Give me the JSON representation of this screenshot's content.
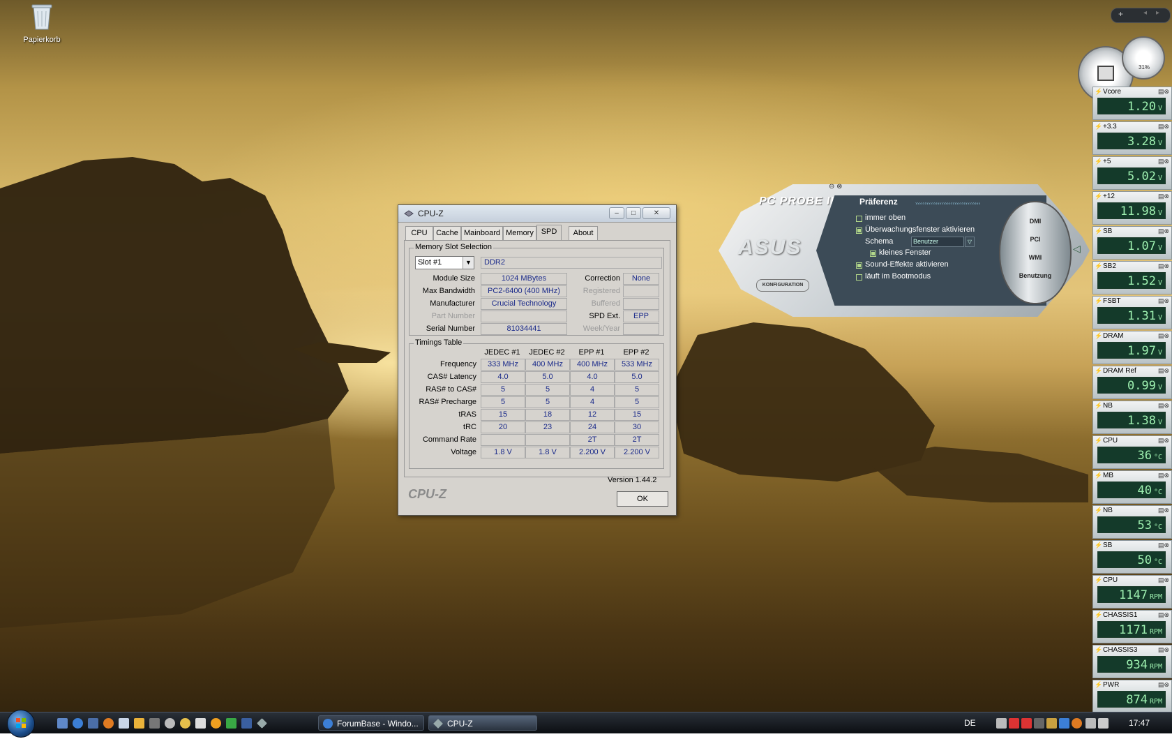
{
  "desktop": {
    "icon_label": "Papierkorb"
  },
  "cpuz": {
    "title": "CPU-Z",
    "tabs": [
      "CPU",
      "Cache",
      "Mainboard",
      "Memory",
      "SPD",
      "About"
    ],
    "active_tab": "SPD",
    "slot_group_title": "Memory Slot Selection",
    "slot_selected": "Slot #1",
    "mem_type": "DDR2",
    "labels": {
      "module_size": "Module Size",
      "max_bandwidth": "Max Bandwidth",
      "manufacturer": "Manufacturer",
      "part_number": "Part Number",
      "serial_number": "Serial Number",
      "correction": "Correction",
      "registered": "Registered",
      "buffered": "Buffered",
      "spd_ext": "SPD Ext.",
      "week_year": "Week/Year"
    },
    "values": {
      "module_size": "1024 MBytes",
      "max_bandwidth": "PC2-6400 (400 MHz)",
      "manufacturer": "Crucial Technology",
      "part_number": "",
      "serial_number": "81034441",
      "correction": "None",
      "registered": "",
      "buffered": "",
      "spd_ext": "EPP",
      "week_year": ""
    },
    "timings": {
      "title": "Timings Table",
      "columns": [
        "JEDEC #1",
        "JEDEC #2",
        "EPP #1",
        "EPP #2"
      ],
      "rows": [
        {
          "label": "Frequency",
          "cells": [
            "333 MHz",
            "400 MHz",
            "400 MHz",
            "533 MHz"
          ]
        },
        {
          "label": "CAS# Latency",
          "cells": [
            "4.0",
            "5.0",
            "4.0",
            "5.0"
          ]
        },
        {
          "label": "RAS# to CAS#",
          "cells": [
            "5",
            "5",
            "4",
            "5"
          ]
        },
        {
          "label": "RAS# Precharge",
          "cells": [
            "5",
            "5",
            "4",
            "5"
          ]
        },
        {
          "label": "tRAS",
          "cells": [
            "15",
            "18",
            "12",
            "15"
          ]
        },
        {
          "label": "tRC",
          "cells": [
            "20",
            "23",
            "24",
            "30"
          ]
        },
        {
          "label": "Command Rate",
          "cells": [
            "",
            "",
            "2T",
            "2T"
          ]
        },
        {
          "label": "Voltage",
          "cells": [
            "1.8 V",
            "1.8 V",
            "2.200 V",
            "2.200 V"
          ]
        }
      ]
    },
    "version": "Version 1.44.2",
    "logo": "CPU-Z",
    "ok_label": "OK"
  },
  "probe": {
    "title": "PC PROBE II",
    "brand": "ASUS",
    "config_label": "KONFIGURATION",
    "pref_title": "Präferenz",
    "items": [
      {
        "label": "immer oben",
        "checked": false
      },
      {
        "label": "Überwachungsfenster aktivieren",
        "checked": true
      },
      {
        "label": "Schema",
        "checked": null
      },
      {
        "label": "kleines Fenster",
        "checked": true
      },
      {
        "label": "Sound-Effekte aktivieren",
        "checked": true
      },
      {
        "label": "läuft im Bootmodus",
        "checked": false
      }
    ],
    "schema_value": "Benutzer",
    "nav_buttons": [
      "DMI",
      "PCI",
      "WMI",
      "Benutzung"
    ]
  },
  "sidebar": {
    "gauge_percent": "31%",
    "sensors": [
      {
        "name": "Vcore",
        "value": "1.20",
        "unit": "V"
      },
      {
        "name": "+3.3",
        "value": "3.28",
        "unit": "V"
      },
      {
        "name": "+5",
        "value": "5.02",
        "unit": "V"
      },
      {
        "name": "+12",
        "value": "11.98",
        "unit": "V"
      },
      {
        "name": "SB",
        "value": "1.07",
        "unit": "V"
      },
      {
        "name": "SB2",
        "value": "1.52",
        "unit": "V"
      },
      {
        "name": "FSBT",
        "value": "1.31",
        "unit": "V"
      },
      {
        "name": "DRAM",
        "value": "1.97",
        "unit": "V"
      },
      {
        "name": "DRAM Ref",
        "value": "0.99",
        "unit": "V"
      },
      {
        "name": "NB",
        "value": "1.38",
        "unit": "V"
      },
      {
        "name": "CPU",
        "value": "36",
        "unit": "°C"
      },
      {
        "name": "MB",
        "value": "40",
        "unit": "°C"
      },
      {
        "name": "NB",
        "value": "53",
        "unit": "°C"
      },
      {
        "name": "SB",
        "value": "50",
        "unit": "°C"
      },
      {
        "name": "CPU",
        "value": "1147",
        "unit": "RPM"
      },
      {
        "name": "CHASSIS1",
        "value": "1171",
        "unit": "RPM"
      },
      {
        "name": "CHASSIS3",
        "value": "934",
        "unit": "RPM"
      },
      {
        "name": "PWR",
        "value": "874",
        "unit": "RPM"
      }
    ]
  },
  "taskbar": {
    "tasks": [
      "ForumBase - Windo...",
      "CPU-Z"
    ],
    "language": "DE",
    "clock": "17:47"
  }
}
